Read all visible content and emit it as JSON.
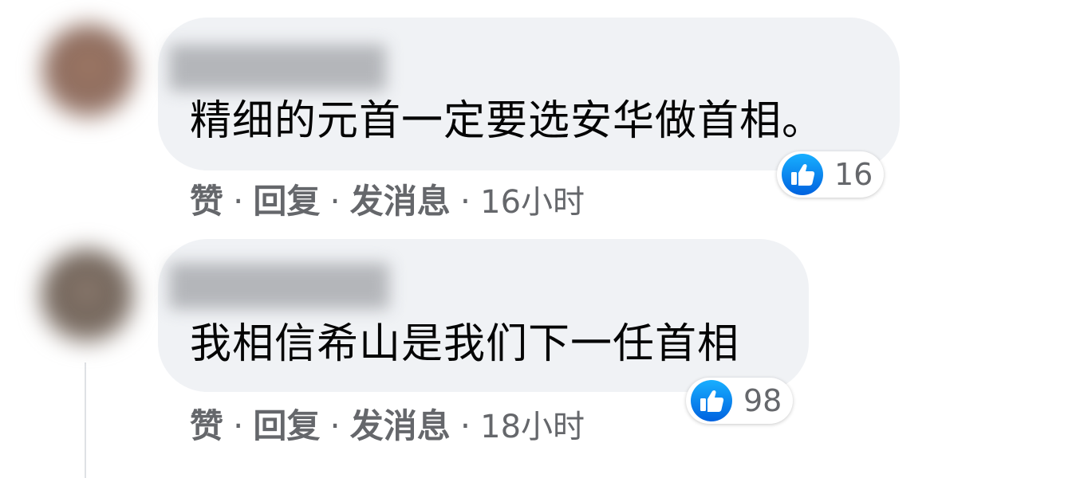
{
  "comments": [
    {
      "text": "精细的元首一定要选安华做首相。",
      "reaction_count": "16",
      "actions": {
        "like": "赞",
        "reply": "回复",
        "message": "发消息"
      },
      "separator": "·",
      "time": "16小时",
      "avatar_color": "#8c6a5c"
    },
    {
      "text": "我相信希山是我们下一任首相",
      "reaction_count": "98",
      "actions": {
        "like": "赞",
        "reply": "回复",
        "message": "发消息"
      },
      "separator": "·",
      "time": "18小时",
      "avatar_color": "#7a6a5e"
    }
  ],
  "colors": {
    "bubble": "#f0f2f5",
    "like_blue": "#1877f2",
    "meta_text": "#65676b",
    "comment_text": "#050505"
  },
  "icons": {
    "reaction": "thumbs-up-icon"
  }
}
